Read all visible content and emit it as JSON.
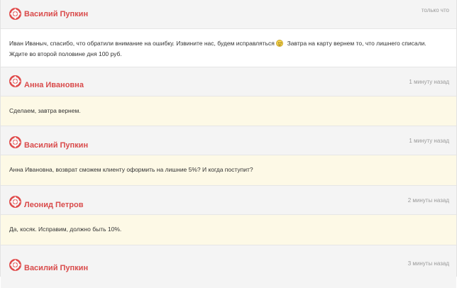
{
  "messages": [
    {
      "author": "Василий Пупкин",
      "time": "только что",
      "text_before": "Иван Иваныч, спасибо, что обратили внимание на ошибку. Извините нас, будем исправляться",
      "emoji": "smile-icon",
      "text_after": " Завтра на карту вернем то, что лишнего списали. Ждите во второй половине дня 100 руб.",
      "background": "#ffffff"
    },
    {
      "author": "Анна Ивановна",
      "time": "1 минуту назад",
      "text": "Сделаем, завтра вернем.",
      "background": "#fdf9e6"
    },
    {
      "author": "Василий Пупкин",
      "time": "1 минуту назад",
      "text": "Анна Ивановна, возврат сможем клиенту оформить на лишние 5%? И когда поступит?",
      "background": "#fdf9e6"
    },
    {
      "author": "Леонид Петров",
      "time": "2 минуты назад",
      "text": "Да, косяк. Исправим, должно быть 10%.",
      "background": "#fdf9e6"
    },
    {
      "author": "Василий Пупкин",
      "time": "3 минуты назад"
    }
  ],
  "colors": {
    "author": "#d94b4b",
    "avatar_icon": "#e04a4a",
    "header_bg": "#f4f4f4",
    "time": "#9a9a9a"
  },
  "icons": {
    "avatar": "lifebuoy-icon"
  }
}
